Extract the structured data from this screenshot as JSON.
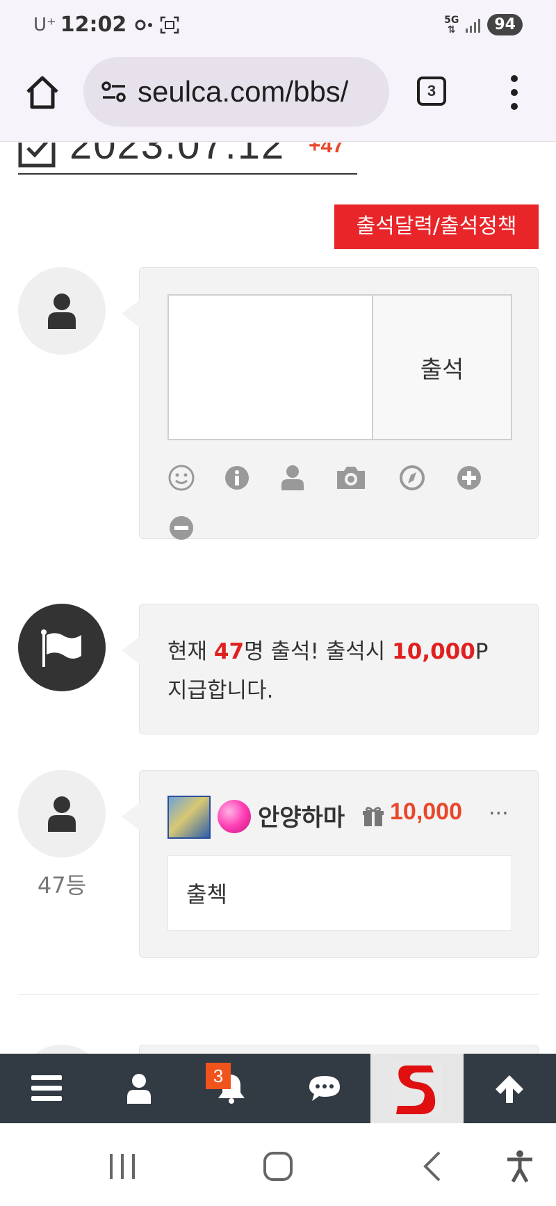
{
  "status_bar": {
    "carrier": "U⁺",
    "time": "12:02",
    "network": "5G",
    "battery": "94",
    "icons": [
      "link-icon",
      "screenshot-icon",
      "signal-icon"
    ]
  },
  "address_bar": {
    "url": "seulca.com/bbs/",
    "tab_count": "3"
  },
  "attendance": {
    "date": "2023.07.12",
    "count_delta": "+47",
    "policy_button": "출석달력/출석정책",
    "submit_button": "출석",
    "toolbar_icons": [
      "smile-icon",
      "info-icon",
      "user-icon",
      "camera-icon",
      "compass-icon",
      "plus-circle-icon",
      "minus-circle-icon"
    ]
  },
  "notice": {
    "prefix": "현재 ",
    "count": "47",
    "middle": "명 출석! 출석시 ",
    "points": "10,000",
    "suffix": "P",
    "line2": "지급합니다."
  },
  "entry": {
    "rank": "47등",
    "username": "안양하마",
    "points": "10,000",
    "more": "...",
    "message": "출첵"
  },
  "bottom_nav": {
    "items": [
      "menu-icon",
      "user-icon",
      "bell-icon",
      "chat-icon",
      "logo",
      "arrow-up-icon"
    ],
    "notification_count": "3"
  },
  "colors": {
    "accent_red": "#e8262a",
    "points_orange": "#e8472b",
    "nav_bg": "#323a43"
  }
}
